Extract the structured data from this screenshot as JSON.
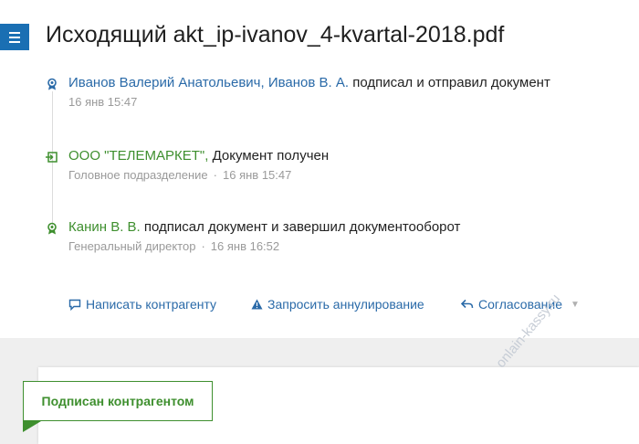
{
  "header": {
    "title": "Исходящий akt_ip-ivanov_4-kvartal-2018.pdf",
    "menu_icon": "hamburger-icon"
  },
  "events": [
    {
      "icon": "seal-icon",
      "actor": "Иванов Валерий Анатольевич, Иванов В. А.",
      "action": "подписал и отправил документ",
      "time": "16 янв 15:47"
    },
    {
      "icon": "inbox-icon",
      "actor": "ООО \"ТЕЛЕМАРКЕТ\",",
      "action": "Документ получен",
      "dept": "Головное подразделение",
      "time": "16 янв 15:47"
    },
    {
      "icon": "seal-icon",
      "actor": "Канин В. В.",
      "action": "подписал документ и завершил документооборот",
      "dept": "Генеральный директор",
      "time": "16 янв 16:52"
    }
  ],
  "actions": {
    "write": "Написать контрагенту",
    "annul": "Запросить аннулирование",
    "approve": "Согласование"
  },
  "status": {
    "label": "Подписан контрагентом"
  },
  "watermark": "onlain-kassy.ru",
  "colors": {
    "accent_blue": "#1a6fb3",
    "link_blue": "#2a6aa8",
    "green": "#3e8f2e",
    "muted": "#9a9a9a"
  }
}
